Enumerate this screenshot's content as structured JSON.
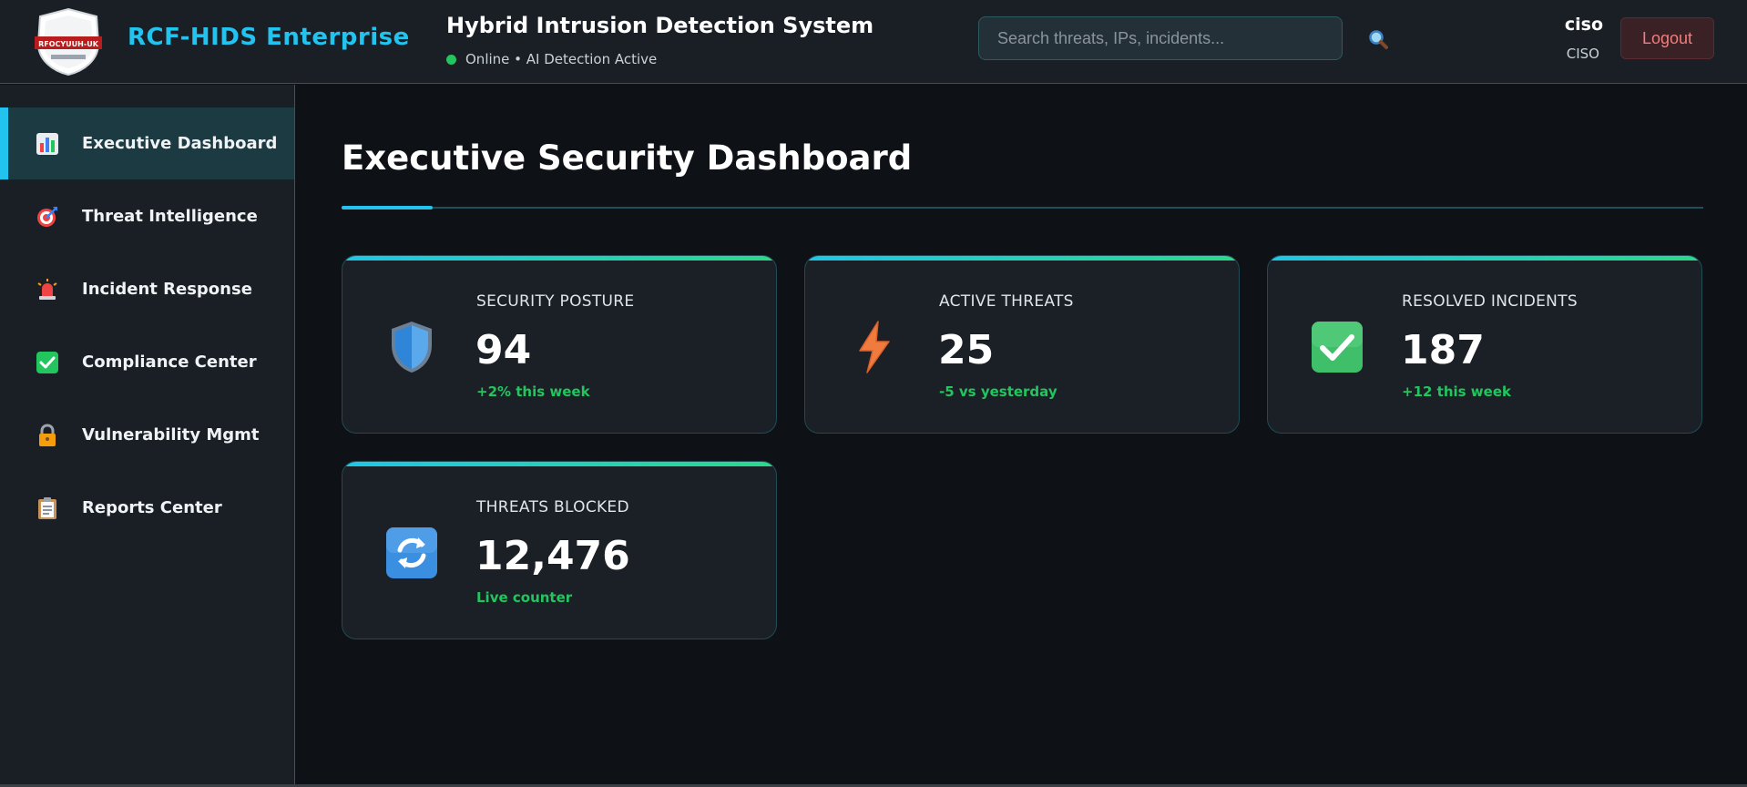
{
  "header": {
    "brand": "RCF-HIDS Enterprise",
    "logo_text": "RFOCYUUH-UK",
    "system_title": "Hybrid Intrusion Detection System",
    "status_text": "Online • AI Detection Active",
    "search_placeholder": "Search threats, IPs, incidents...",
    "search_icon": "magnifier-icon",
    "user_name": "ciso",
    "user_role": "CISO",
    "logout_label": "Logout",
    "colors": {
      "accent": "#22c3ee",
      "status_online": "#22c55e",
      "logout": "#f47c7c"
    }
  },
  "sidebar": {
    "items": [
      {
        "label": "Executive Dashboard",
        "icon": "bar-chart-icon",
        "active": true
      },
      {
        "label": "Threat Intelligence",
        "icon": "target-icon",
        "active": false
      },
      {
        "label": "Incident Response",
        "icon": "siren-icon",
        "active": false
      },
      {
        "label": "Compliance Center",
        "icon": "check-box-icon",
        "active": false
      },
      {
        "label": "Vulnerability Mgmt",
        "icon": "lock-icon",
        "active": false
      },
      {
        "label": "Reports Center",
        "icon": "clipboard-icon",
        "active": false
      }
    ]
  },
  "main": {
    "title": "Executive Security Dashboard",
    "cards": [
      {
        "label": "SECURITY POSTURE",
        "value": "94",
        "delta": "+2% this week",
        "icon": "shield-icon"
      },
      {
        "label": "ACTIVE THREATS",
        "value": "25",
        "delta": "-5 vs yesterday",
        "icon": "lightning-icon"
      },
      {
        "label": "RESOLVED INCIDENTS",
        "value": "187",
        "delta": "+12 this week",
        "icon": "check-mark-icon"
      },
      {
        "label": "THREATS BLOCKED",
        "value": "12,476",
        "delta": "Live counter",
        "icon": "refresh-icon"
      }
    ]
  }
}
